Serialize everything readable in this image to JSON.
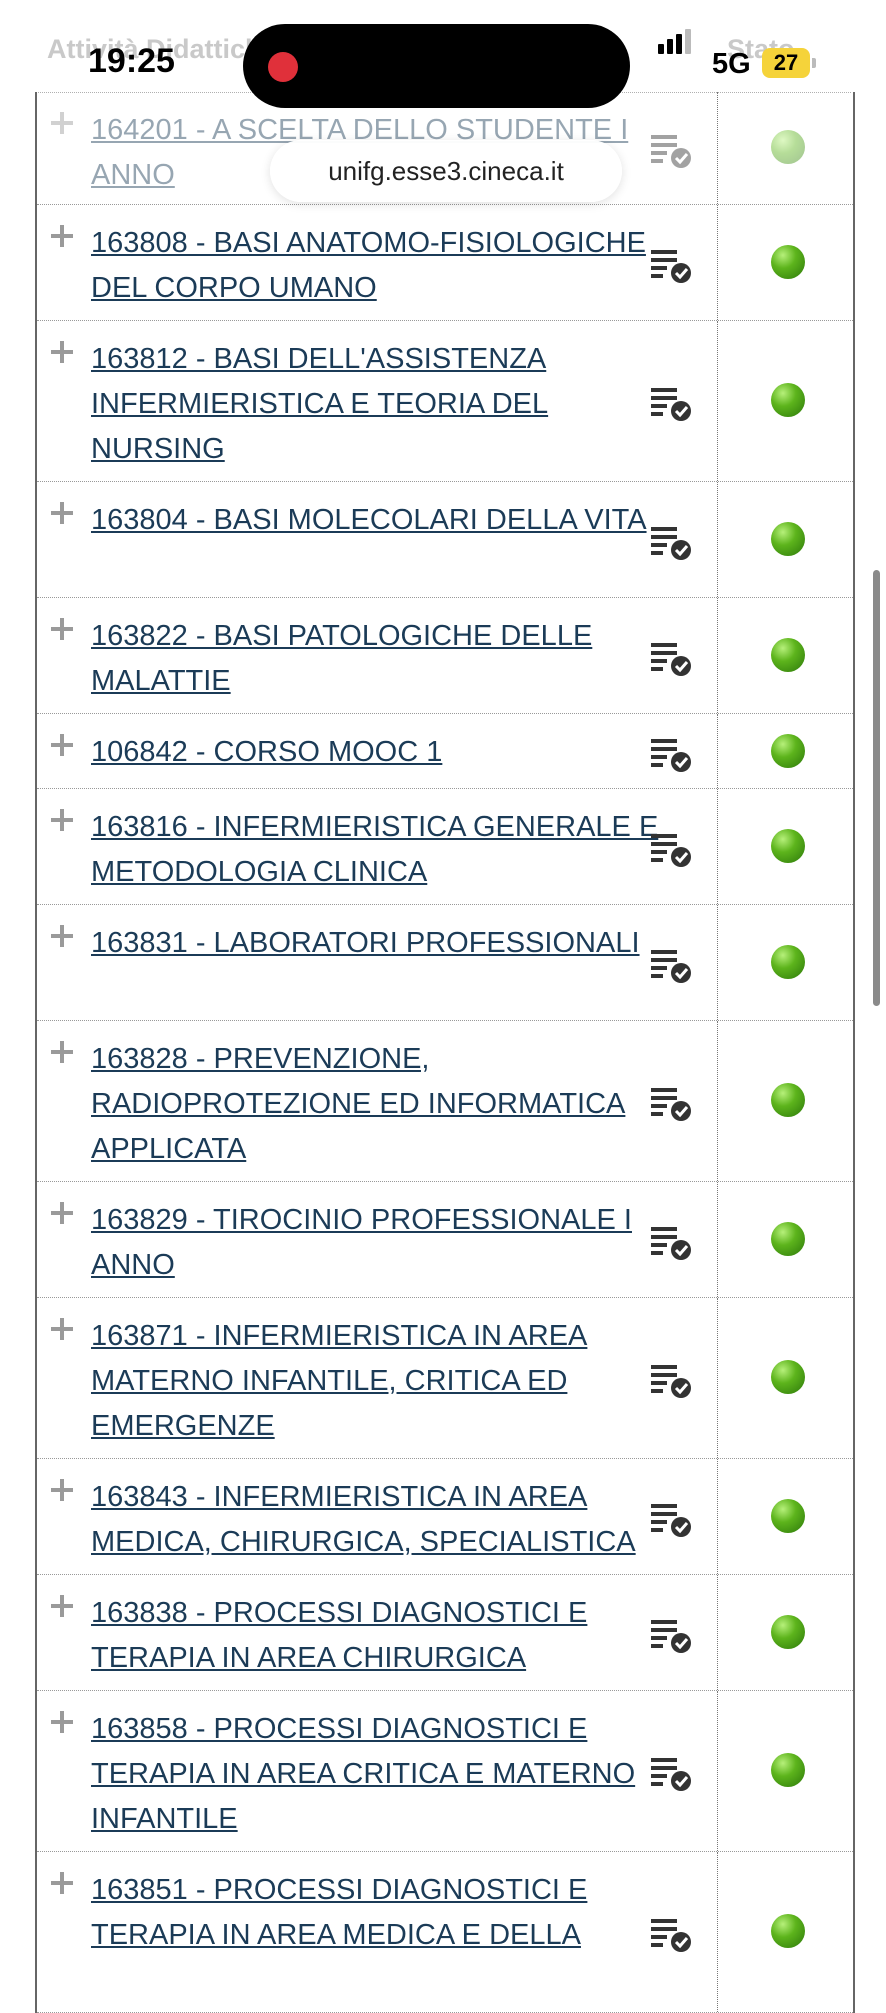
{
  "status_bar": {
    "time": "19:25",
    "network": "5G",
    "battery": "27"
  },
  "browser": {
    "url": "unifg.esse3.cineca.it"
  },
  "table": {
    "header": {
      "activity": "Attività Didattiche",
      "status": "Stato"
    },
    "rows": [
      {
        "label": "164201 - A SCELTA DELLO STUDENTE I ANNO"
      },
      {
        "label": "163808 - BASI ANATOMO-FISIOLOGICHE DEL CORPO UMANO"
      },
      {
        "label": "163812 - BASI DELL'ASSISTENZA INFERMIERISTICA E TEORIA DEL NURSING"
      },
      {
        "label": "163804 - BASI MOLECOLARI DELLA VITA"
      },
      {
        "label": "163822 - BASI PATOLOGICHE DELLE MALATTIE"
      },
      {
        "label": "106842 - CORSO MOOC 1"
      },
      {
        "label": "163816 - INFERMIERISTICA GENERALE E METODOLOGIA CLINICA"
      },
      {
        "label": "163831 - LABORATORI PROFESSIONALI"
      },
      {
        "label": "163828 - PREVENZIONE, RADIOPROTEZIONE ED INFORMATICA APPLICATA"
      },
      {
        "label": "163829 - TIROCINIO PROFESSIONALE I ANNO"
      },
      {
        "label": "163871 - INFERMIERISTICA IN AREA MATERNO INFANTILE, CRITICA ED EMERGENZE"
      },
      {
        "label": "163843 - INFERMIERISTICA IN AREA MEDICA, CHIRURGICA, SPECIALISTICA"
      },
      {
        "label": "163838 - PROCESSI DIAGNOSTICI E TERAPIA IN AREA CHIRURGICA"
      },
      {
        "label": "163858 - PROCESSI DIAGNOSTICI E TERAPIA IN AREA CRITICA E MATERNO INFANTILE"
      },
      {
        "label": "163851 - PROCESSI DIAGNOSTICI E TERAPIA IN AREA MEDICA E DELLA"
      }
    ]
  },
  "colors": {
    "link": "#1b3b57",
    "status_green": "#5db41c",
    "separator": "#999999"
  },
  "icons": {
    "expand": "plus-icon",
    "action": "checklist-icon",
    "status": "green-status-dot"
  }
}
